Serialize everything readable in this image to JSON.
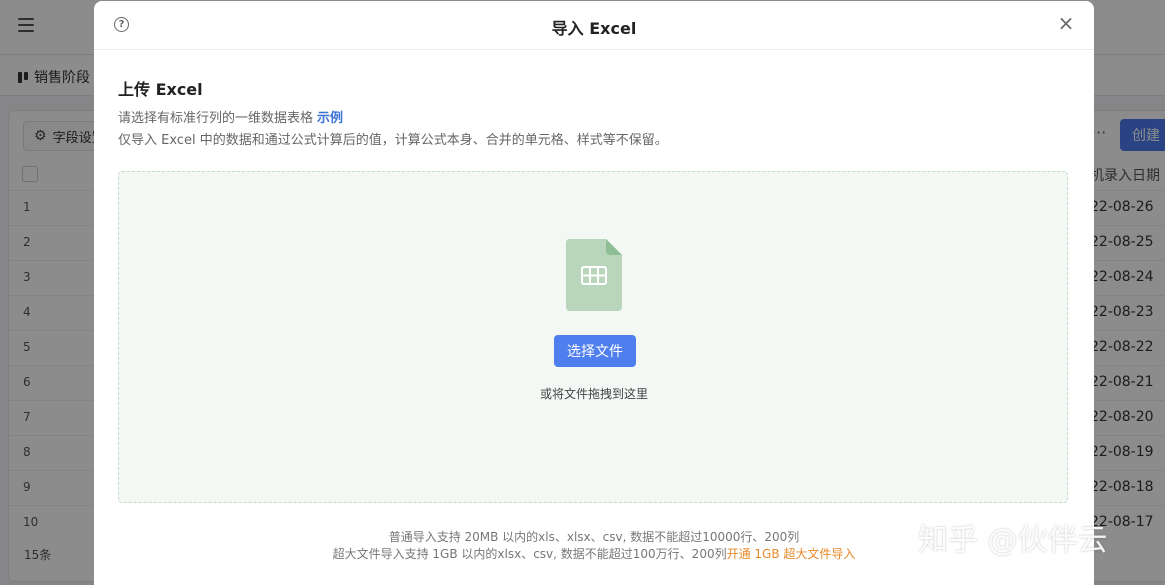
{
  "background": {
    "stage_tab": "销售阶段",
    "field_settings": "字段设置",
    "more_label": "···",
    "create_button": "创建",
    "date_column_header": "机录入日期",
    "row_numbers": [
      "1",
      "2",
      "3",
      "4",
      "5",
      "6",
      "7",
      "8",
      "9",
      "10"
    ],
    "dates": [
      "22-08-26",
      "22-08-25",
      "22-08-24",
      "22-08-23",
      "22-08-22",
      "22-08-21",
      "22-08-20",
      "22-08-19",
      "22-08-18",
      "22-08-17"
    ],
    "record_count": "15条"
  },
  "modal": {
    "title": "导入 Excel",
    "section_title": "上传 Excel",
    "description_line1": "请选择有标准行列的一维数据表格",
    "example_link": "示例",
    "description_line2": "仅导入 Excel 中的数据和通过公式计算后的值，计算公式本身、合并的单元格、样式等不保留。",
    "choose_file_button": "选择文件",
    "drag_hint": "或将文件拖拽到这里",
    "note_line1": "普通导入支持 20MB 以内的xls、xlsx、csv, 数据不能超过10000行、200列",
    "note_line2": "超大文件导入支持 1GB 以内的xlsx、csv, 数据不能超过100万行、200列",
    "upgrade_link": "开通 1GB 超大文件导入"
  },
  "watermark": "知乎 @伙伴云",
  "colors": {
    "primary_button": "#4f7fee",
    "link_blue": "#3c73d6",
    "link_orange": "#e8892b",
    "dropzone_bg": "#f3f8f4",
    "file_icon": "#b9d6bd"
  },
  "icons": [
    "menu-icon",
    "kanban-icon",
    "gear-icon",
    "help-icon",
    "close-icon",
    "spreadsheet-file-icon"
  ]
}
